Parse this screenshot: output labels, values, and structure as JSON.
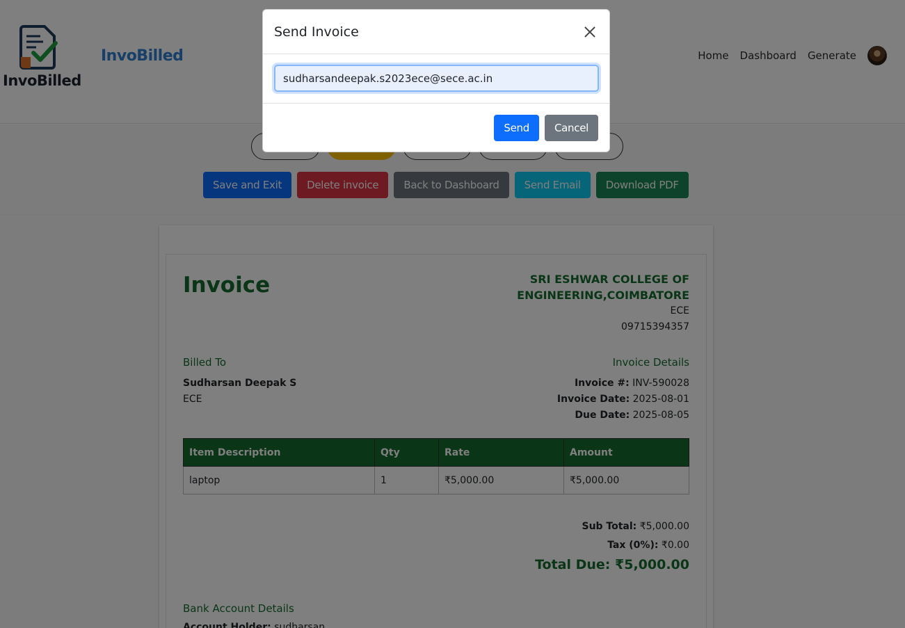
{
  "header": {
    "logo_text": "InvoBilled",
    "brand": "InvoBilled",
    "nav": [
      "Home",
      "Dashboard",
      "Generate"
    ]
  },
  "toolbar": {
    "buttons": {
      "save": "Save and Exit",
      "delete": "Delete invoice",
      "back": "Back to Dashboard",
      "email": "Send Email",
      "pdf": "Download PDF"
    }
  },
  "invoice": {
    "title": "Invoice",
    "company": {
      "name": "SRI ESHWAR COLLEGE OF ENGINEERING,COIMBATORE",
      "dept": "ECE",
      "phone": "09715394357"
    },
    "billed_to": {
      "heading": "Billed To",
      "name": "Sudharsan Deepak S",
      "dept": "ECE"
    },
    "details": {
      "heading": "Invoice Details",
      "number_label": "Invoice #:",
      "number": "INV-590028",
      "date_label": "Invoice Date:",
      "date": "2025-08-01",
      "due_label": "Due Date:",
      "due": "2025-08-05"
    },
    "table": {
      "headers": [
        "Item Description",
        "Qty",
        "Rate",
        "Amount"
      ],
      "rows": [
        [
          "laptop",
          "1",
          "₹5,000.00",
          "₹5,000.00"
        ]
      ]
    },
    "totals": {
      "subtotal_label": "Sub Total:",
      "subtotal": "₹5,000.00",
      "tax_label": "Tax (0%):",
      "tax": "₹0.00",
      "due_label": "Total Due:",
      "due": "₹5,000.00"
    },
    "bank": {
      "heading": "Bank Account Details",
      "holder_label": "Account Holder:",
      "holder": "sudharsan"
    }
  },
  "modal": {
    "title": "Send Invoice",
    "email_value": "sudharsandeepak.s2023ece@sece.ac.in",
    "send": "Send",
    "cancel": "Cancel"
  },
  "colors": {
    "accent_green": "#146c2e",
    "brand_blue": "#2f7fd1",
    "primary": "#0d6efd"
  }
}
